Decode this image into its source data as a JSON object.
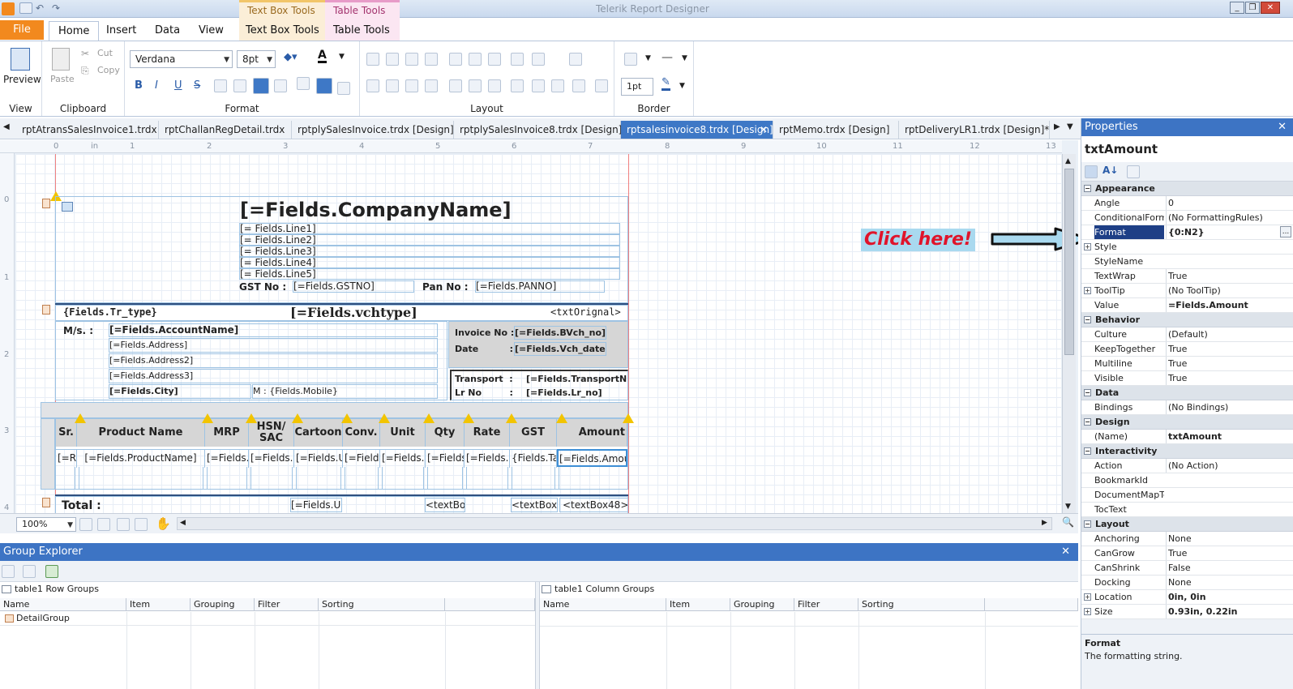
{
  "window": {
    "title": "Telerik Report Designer",
    "minimize": "_",
    "restore": "❐",
    "close": "✕"
  },
  "context_tabs": {
    "textbox_group": "Text Box Tools",
    "table_group": "Table Tools"
  },
  "ribbon_tabs": [
    {
      "label": "Home"
    },
    {
      "label": "Insert"
    },
    {
      "label": "Data"
    },
    {
      "label": "View"
    },
    {
      "label": "Text Box Tools"
    },
    {
      "label": "Table Tools"
    }
  ],
  "file_tab": "File",
  "ribbon": {
    "preview": "Preview",
    "paste": "Paste",
    "cut": "Cut",
    "copy": "Copy",
    "font_name": "Verdana",
    "font_size": "8pt",
    "border_width": "1pt",
    "groups": {
      "view": "View",
      "clipboard": "Clipboard",
      "format": "Format",
      "layout": "Layout",
      "border": "Border"
    },
    "bold": "B",
    "italic": "I",
    "underline": "U",
    "strike": "S"
  },
  "doc_tabs": [
    "rptAtransSalesInvoice1.trdx",
    "rptChallanRegDetail.trdx",
    "rptplySalesInvoice.trdx [Design]",
    "rptplySalesInvoice8.trdx [Design]",
    "rptsalesinvoice8.trdx [Design]",
    "rptMemo.trdx [Design]",
    "rptDeliveryLR1.trdx [Design]*"
  ],
  "ruler": {
    "unit": "in",
    "marks": [
      "0",
      "1",
      "2",
      "3",
      "4",
      "5",
      "6",
      "7",
      "8",
      "9",
      "10",
      "11",
      "12",
      "13"
    ],
    "vmarks": [
      "0",
      "0",
      "1",
      "2",
      "3",
      "4"
    ]
  },
  "report": {
    "company": "[=Fields.CompanyName]",
    "lines": [
      "[= Fields.Line1]",
      "[= Fields.Line2]",
      "[= Fields.Line3]",
      "[= Fields.Line4]",
      "[= Fields.Line5]"
    ],
    "gst_label": "GST No :",
    "gst_value": "[=Fields.GSTNO]",
    "pan_label": "Pan No :",
    "pan_value": "[=Fields.PANNO]",
    "tr_type": "{Fields.Tr_type}",
    "vchtype": "[=Fields.vchtype]",
    "orignal": "<txtOrignal>",
    "ms_label": "M/s. :",
    "account": "[=Fields.AccountName]",
    "address": "[=Fields.Address]",
    "address2": "[=Fields.Address2]",
    "address3": "[=Fields.Address3]",
    "city": "[=Fields.City]",
    "mobile": "M : {Fields.Mobile}",
    "invoice_label": "Invoice No :",
    "invoice_value": "[=Fields.BVch_no]",
    "date_label": "Date          :",
    "date_value": "[=Fields.Vch_date]",
    "transport_label": "Transport  :",
    "transport_value": "[=Fields.TransportN",
    "lr_label": "Lr No         :",
    "lr_value": "[=Fields.Lr_no]",
    "headers": [
      "Sr.",
      "Product Name",
      "MRP",
      "HSN/ SAC",
      "Cartoon",
      "Conv.",
      "Unit",
      "Qty",
      "Rate",
      "GST",
      "Amount"
    ],
    "cells": [
      "[=R",
      "[=Fields.ProductName]",
      "[=Fields.",
      "[=Fields.",
      "[=Fields.U",
      "[=Field",
      "[=Fields.",
      "[=Fields",
      "[=Fields.",
      "{Fields.Ta",
      "[=Fields.Amoun"
    ],
    "total_label": "Total :",
    "total_cells": [
      "[=Fields.U",
      "<textBo",
      "<textBox",
      "<textBox48>"
    ]
  },
  "annotation": {
    "text": "Click here!"
  },
  "zoom": "100%",
  "group_explorer": {
    "title": "Group Explorer",
    "close": "✕",
    "row_groups": "table1 Row Groups",
    "col_groups": "table1 Column Groups",
    "columns": [
      "Name",
      "Item",
      "Grouping",
      "Filter",
      "Sorting"
    ],
    "row_items": [
      "DetailGroup"
    ]
  },
  "properties": {
    "title": "Properties",
    "close": "✕",
    "object": "txtAmount",
    "categories": [
      {
        "name": "Appearance",
        "rows": [
          [
            "Angle",
            "0"
          ],
          [
            "ConditionalForm",
            "(No FormattingRules)"
          ],
          [
            "Format",
            "{0:N2}"
          ],
          [
            "Style",
            ""
          ],
          [
            "StyleName",
            ""
          ],
          [
            "TextWrap",
            "True"
          ],
          [
            "ToolTip",
            "(No ToolTip)"
          ],
          [
            "Value",
            "=Fields.Amount"
          ]
        ]
      },
      {
        "name": "Behavior",
        "rows": [
          [
            "Culture",
            "(Default)"
          ],
          [
            "KeepTogether",
            "True"
          ],
          [
            "Multiline",
            "True"
          ],
          [
            "Visible",
            "True"
          ]
        ]
      },
      {
        "name": "Data",
        "rows": [
          [
            "Bindings",
            "(No Bindings)"
          ]
        ]
      },
      {
        "name": "Design",
        "rows": [
          [
            "(Name)",
            "txtAmount"
          ]
        ]
      },
      {
        "name": "Interactivity",
        "rows": [
          [
            "Action",
            "(No Action)"
          ],
          [
            "BookmarkId",
            ""
          ],
          [
            "DocumentMapTe",
            ""
          ],
          [
            "TocText",
            ""
          ]
        ]
      },
      {
        "name": "Layout",
        "rows": [
          [
            "Anchoring",
            "None"
          ],
          [
            "CanGrow",
            "True"
          ],
          [
            "CanShrink",
            "False"
          ],
          [
            "Docking",
            "None"
          ],
          [
            "Location",
            "0in, 0in"
          ],
          [
            "Size",
            "0.93in, 0.22in"
          ]
        ]
      }
    ],
    "help_title": "Format",
    "help_text": "The formatting string."
  },
  "colors": {
    "accent": "#3e78c6",
    "file": "#f2891e",
    "annotation": "#e0142a"
  }
}
